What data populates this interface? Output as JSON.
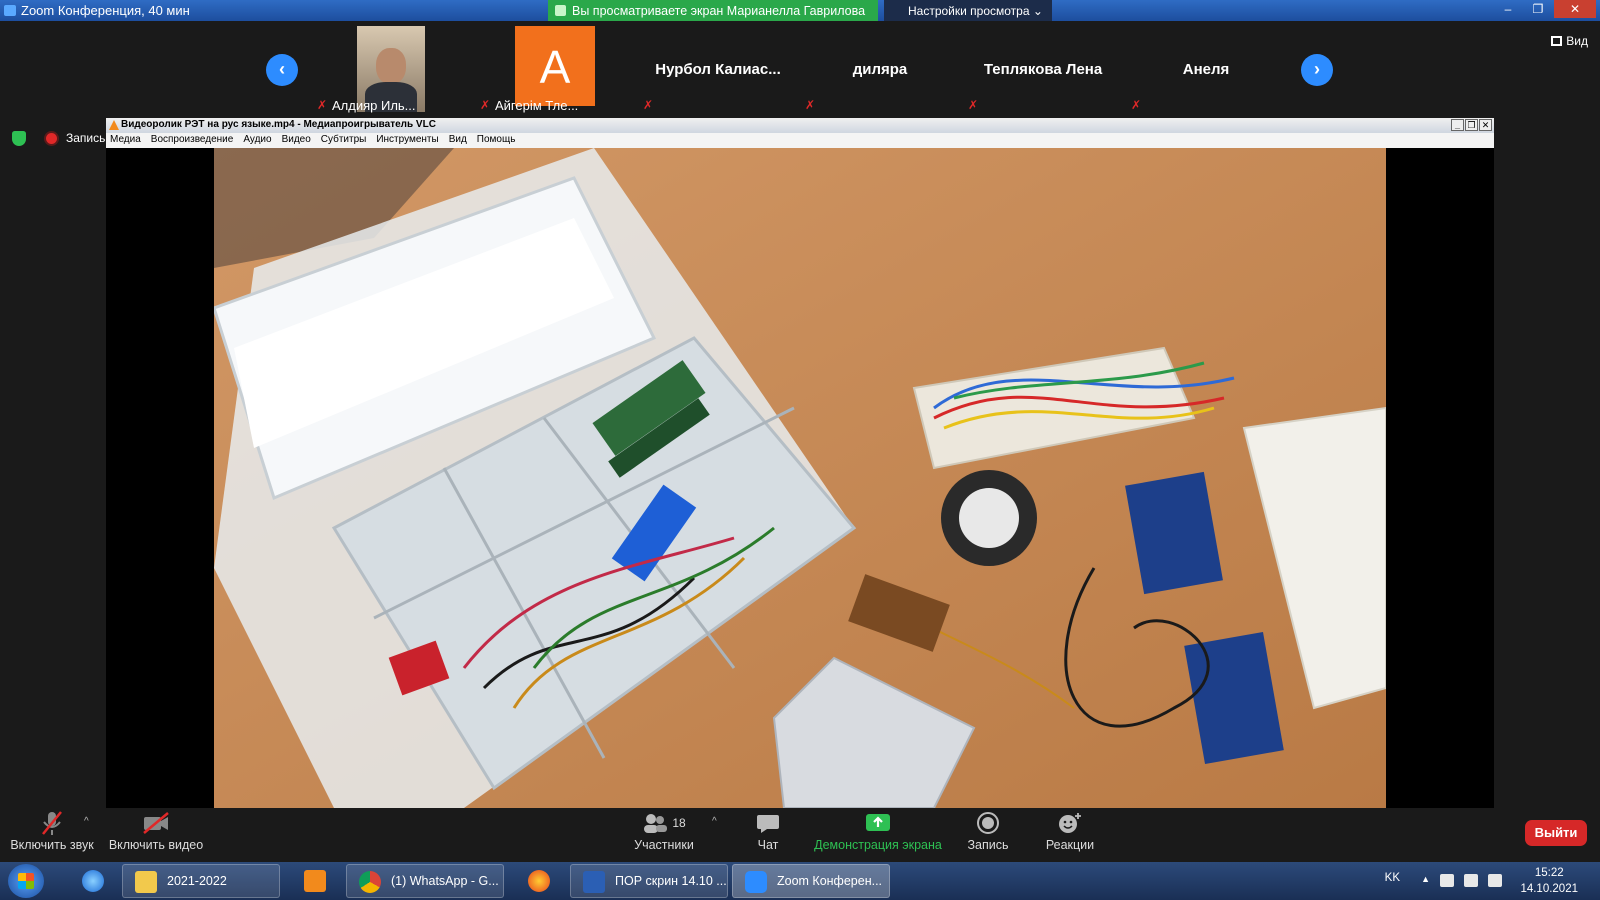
{
  "window": {
    "title": "Zoom Конференция, 40 мин",
    "share_banner": "Вы просматриваете экран Марианелла Гаврилова",
    "view_settings": "Настройки просмотра",
    "view_button": "Вид"
  },
  "participants": [
    {
      "name": "Алдияр Иль...",
      "muted": true,
      "type": "photo"
    },
    {
      "name": "Айгерім Тле...",
      "muted": true,
      "type": "avatar",
      "initial": "A"
    },
    {
      "name": "Нурбол  Калиас...",
      "muted": true,
      "type": "name"
    },
    {
      "name": "дилярa",
      "muted": true,
      "type": "name"
    },
    {
      "name": "Теплякова Лена",
      "muted": true,
      "type": "name"
    },
    {
      "name": "Анеля",
      "muted": true,
      "type": "name"
    }
  ],
  "recording": {
    "label": "Запись"
  },
  "vlc": {
    "title": "Видеоролик РЭТ на рус языке.mp4 - Медиапроигрыватель VLC",
    "menu": [
      "Медиа",
      "Воспроизведение",
      "Аудио",
      "Видео",
      "Субтитры",
      "Инструменты",
      "Вид",
      "Помощь"
    ]
  },
  "toolbar": {
    "unmute": "Включить звук",
    "start_video": "Включить видео",
    "participants": "Участники",
    "participants_count": "18",
    "chat": "Чат",
    "share_screen": "Демонстрация экрана",
    "record": "Запись",
    "reactions": "Реакции",
    "leave": "Выйти"
  },
  "taskbar": {
    "apps": [
      {
        "label": "2021-2022",
        "icon": "folder-icon"
      },
      {
        "label": "",
        "icon": "media-player-icon"
      },
      {
        "label": "(1) WhatsApp - G...",
        "icon": "chrome-icon"
      },
      {
        "label": "",
        "icon": "firefox-icon"
      },
      {
        "label": "ПОР скрин 14.10 ...",
        "icon": "word-icon"
      },
      {
        "label": "Zoom Конферен...",
        "icon": "zoom-icon"
      }
    ],
    "language": "KK",
    "time": "15:22",
    "date": "14.10.2021"
  },
  "colors": {
    "accent": "#2d8cff",
    "share_green": "#2aa84a",
    "leave_red": "#d62828",
    "avatar_orange": "#f2701c"
  }
}
